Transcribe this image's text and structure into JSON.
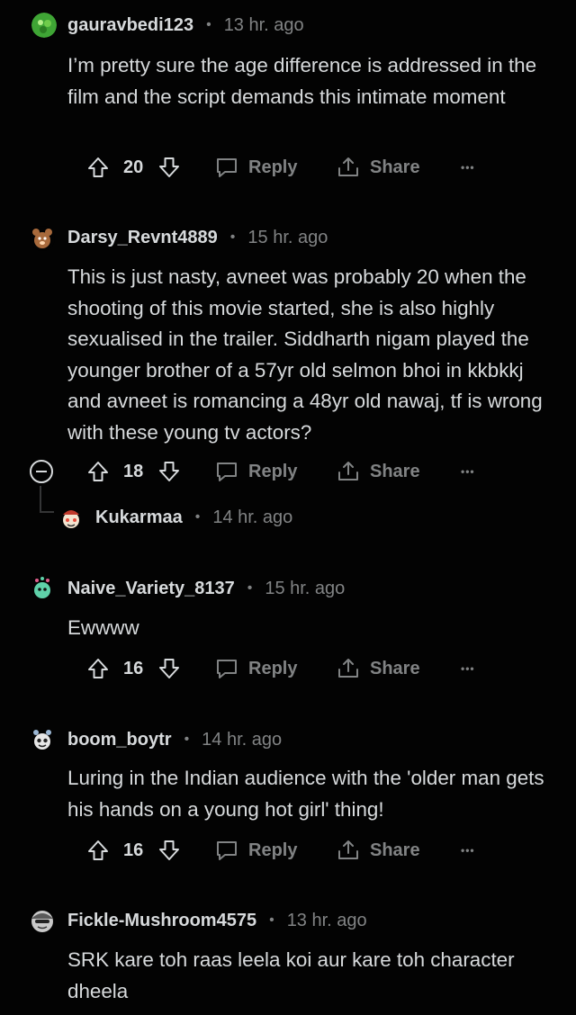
{
  "labels": {
    "reply": "Reply",
    "share": "Share",
    "more": "•••"
  },
  "comments": [
    {
      "username": "gauravbedi123",
      "time": "13 hr. ago",
      "avatar_icon": "green-blob-avatar",
      "body": "I’m pretty sure the age difference is addressed in the film and the script demands this intimate moment",
      "votes": "20"
    },
    {
      "username": "Darsy_Revnt4889",
      "time": "15 hr. ago",
      "avatar_icon": "bear-avatar",
      "body": "This is just nasty, avneet was probably 20 when the shooting of this movie started, she is also highly sexualised in the trailer. Siddharth nigam played the younger brother of a 57yr old selmon bhoi in kkbkkj and avneet is romancing a 48yr old nawaj, tf is wrong with these young tv actors?",
      "votes": "18"
    },
    {
      "username": "Kukarmaa",
      "time": "14 hr. ago",
      "avatar_icon": "snoo-avatar"
    },
    {
      "username": "Naive_Variety_8137",
      "time": "15 hr. ago",
      "avatar_icon": "green-snoo-avatar",
      "body": "Ewwww",
      "votes": "16"
    },
    {
      "username": "boom_boytr",
      "time": "14 hr. ago",
      "avatar_icon": "white-snoo-avatar",
      "body": "Luring in the Indian audience with the 'older man gets his hands on a young hot girl' thing!",
      "votes": "16"
    },
    {
      "username": "Fickle-Mushroom4575",
      "time": "13 hr. ago",
      "avatar_icon": "capped-snoo-avatar",
      "body": "SRK kare toh raas leela koi aur kare toh character dheela"
    }
  ]
}
